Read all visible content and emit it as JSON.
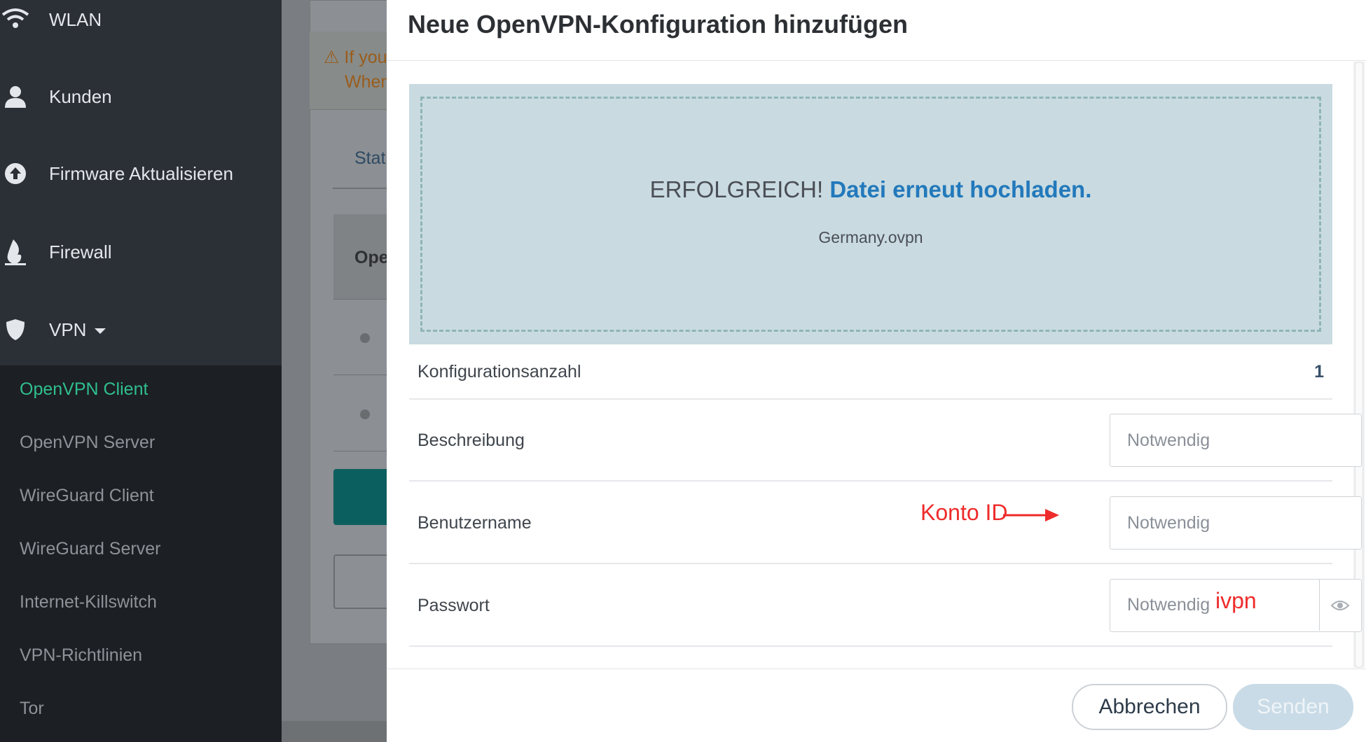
{
  "sidebar": {
    "items": [
      {
        "label": "WLAN",
        "icon": "wifi-icon"
      },
      {
        "label": "Kunden",
        "icon": "user-icon"
      },
      {
        "label": "Firmware Aktualisieren",
        "icon": "upload-icon"
      },
      {
        "label": "Firewall",
        "icon": "flame-icon"
      },
      {
        "label": "VPN",
        "icon": "shield-icon"
      }
    ],
    "vpn_submenu": [
      {
        "label": "OpenVPN Client",
        "active": true
      },
      {
        "label": "OpenVPN Server",
        "active": false
      },
      {
        "label": "WireGuard Client",
        "active": false
      },
      {
        "label": "WireGuard Server",
        "active": false
      },
      {
        "label": "Internet-Killswitch",
        "active": false
      },
      {
        "label": "VPN-Richtlinien",
        "active": false
      },
      {
        "label": "Tor",
        "active": false
      }
    ],
    "active_color": "#2fbf8e"
  },
  "background": {
    "warning_line1": "If you",
    "warning_line2": "When",
    "tab_partial": "Stat",
    "table_header_partial": "Ope"
  },
  "modal": {
    "title": "Neue OpenVPN-Konfiguration hinzufügen",
    "upload": {
      "status": "ERFOLGREICH!",
      "reupload_link": "Datei erneut hochladen.",
      "filename": "Germany.ovpn"
    },
    "config_count": {
      "label": "Konfigurationsanzahl",
      "value": "1"
    },
    "description": {
      "label": "Beschreibung",
      "placeholder": "Notwendig"
    },
    "username": {
      "label": "Benutzername",
      "placeholder": "Notwendig",
      "annotation": "Konto ID"
    },
    "password": {
      "label": "Passwort",
      "placeholder": "Notwendig",
      "annotation": "ivpn",
      "toggle_icon": "eye-icon"
    },
    "buttons": {
      "cancel": "Abbrechen",
      "send": "Senden"
    },
    "link_color": "#2379bb",
    "annotation_color": "#ee2b2b"
  }
}
